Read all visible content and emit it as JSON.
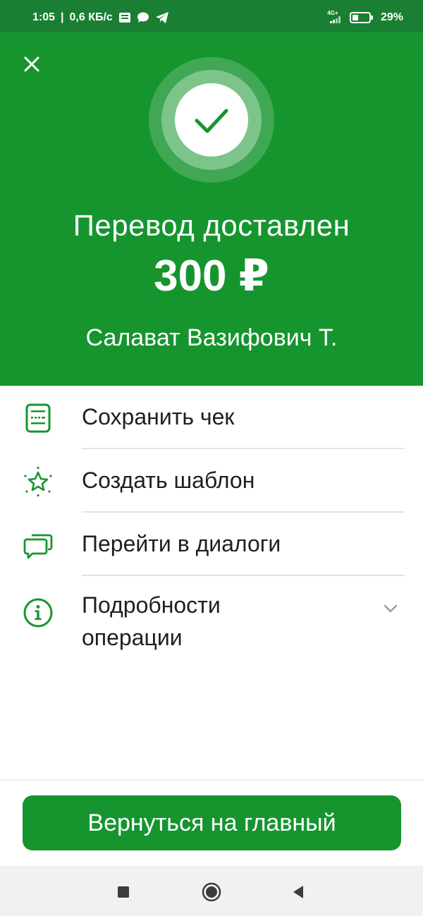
{
  "status_bar": {
    "time": "1:05",
    "speed": "0,6 КБ/с",
    "network_type": "4G+",
    "battery": "29%"
  },
  "header": {
    "title": "Перевод доставлен",
    "amount": "300 ₽",
    "recipient": "Салават Вазифович Т."
  },
  "actions": {
    "save_receipt": "Сохранить чек",
    "create_template": "Создать шаблон",
    "go_to_dialogs": "Перейти в диалоги",
    "operation_details_line1": "Подробности",
    "operation_details_line2": "операции"
  },
  "primary_button": "Вернуться на главный",
  "colors": {
    "brand_green": "#16952f",
    "status_bar_green": "#1a7f32",
    "text": "#1f1f1f"
  }
}
